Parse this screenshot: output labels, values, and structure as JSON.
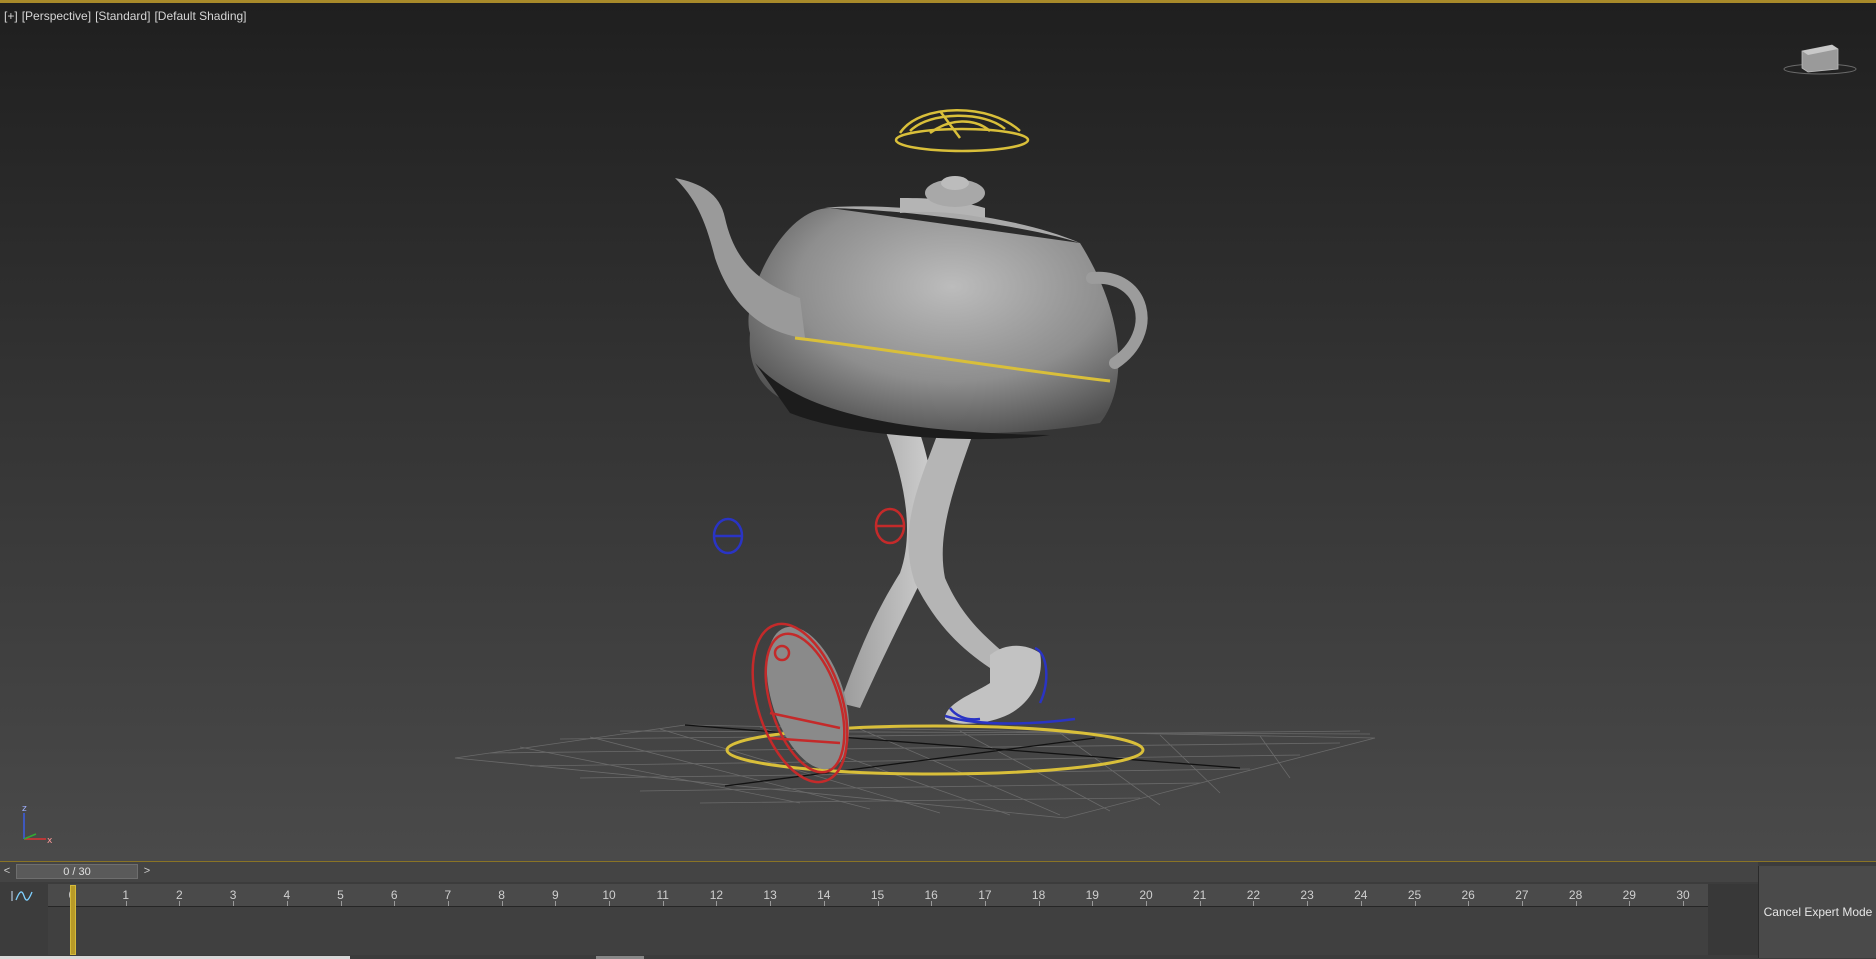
{
  "viewport": {
    "label_plus": "[+]",
    "label_view": "[Perspective]",
    "label_mode": "[Standard]",
    "label_shading": "[Default Shading]",
    "axis_z": "z",
    "axis_x": "x"
  },
  "timeline": {
    "prev_label": "<",
    "next_label": ">",
    "frame_display": "0 / 30",
    "current_frame": 0,
    "total_frames": 30,
    "ticks": [
      "0",
      "1",
      "2",
      "3",
      "4",
      "5",
      "6",
      "7",
      "8",
      "9",
      "10",
      "11",
      "12",
      "13",
      "14",
      "15",
      "16",
      "17",
      "18",
      "19",
      "20",
      "21",
      "22",
      "23",
      "24",
      "25",
      "26",
      "27",
      "28",
      "29",
      "30"
    ],
    "cancel_expert_label": "Cancel Expert Mode"
  },
  "colors": {
    "accent": "#b79a27",
    "control_yellow": "#d9bf3a",
    "control_red": "#c42a2a",
    "control_blue": "#2a34c4"
  }
}
